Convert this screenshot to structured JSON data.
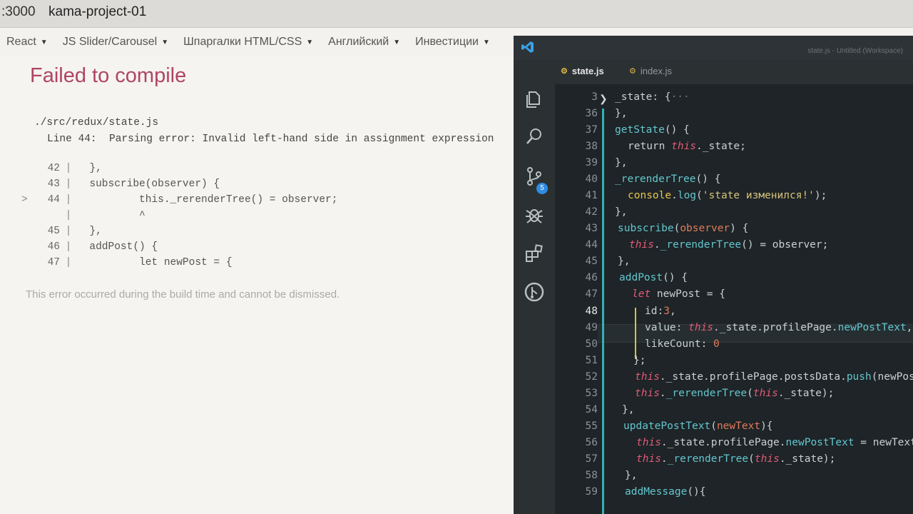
{
  "browser": {
    "tab_url": ":3000",
    "tab_title": "kama-project-01",
    "bookmarks": [
      "React",
      "JS Slider/Carousel",
      "Шпаргалки HTML/CSS",
      "Английский",
      "Инвестиции"
    ]
  },
  "error_overlay": {
    "title": "Failed to compile",
    "file": "./src/redux/state.js",
    "message": "Line 44:  Parsing error: Invalid left-hand side in assignment expression",
    "snippet": [
      {
        "marker": "",
        "num": "42",
        "code": "  },"
      },
      {
        "marker": "",
        "num": "43",
        "code": "  subscribe(observer) {"
      },
      {
        "marker": ">",
        "num": "44",
        "code": "          this._rerenderTree() = observer;"
      },
      {
        "marker": "",
        "num": "",
        "code": "          ^"
      },
      {
        "marker": "",
        "num": "45",
        "code": "  },"
      },
      {
        "marker": "",
        "num": "46",
        "code": "  addPost() {"
      },
      {
        "marker": "",
        "num": "47",
        "code": "          let newPost = {"
      }
    ],
    "footer": "This error occurred during the build time and cannot be dismissed."
  },
  "vscode": {
    "window_title": "state.js - Untitled (Workspace)",
    "scm_badge": "5",
    "tabs": [
      {
        "label": "state.js",
        "active": true,
        "icon": "js-file-icon"
      },
      {
        "label": "index.js",
        "active": false,
        "icon": "js-file-icon"
      }
    ],
    "active_line": "48",
    "line_numbers": [
      "3",
      "36",
      "37",
      "38",
      "39",
      "40",
      "41",
      "42",
      "43",
      "44",
      "45",
      "46",
      "47",
      "48",
      "49",
      "50",
      "51",
      "52",
      "53",
      "54",
      "55",
      "56",
      "57",
      "58",
      "59"
    ],
    "colors": {
      "keyword": "#e05a75",
      "function": "#63c6cf",
      "guide": "#35b0b8",
      "number": "#e07a5a"
    }
  }
}
